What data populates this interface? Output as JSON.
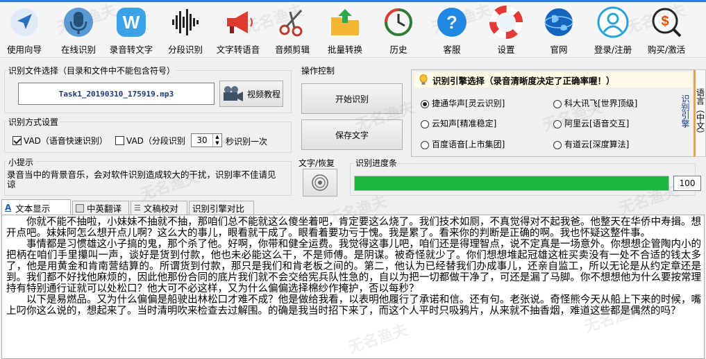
{
  "toolbar": {
    "items": [
      {
        "label": "使用向导",
        "icon": "arrow-cursor-icon"
      },
      {
        "label": "在线识别",
        "icon": "microphone-icon"
      },
      {
        "label": "录音转文字",
        "icon": "w-badge-icon"
      },
      {
        "label": "分段识别",
        "icon": "waveform-icon"
      },
      {
        "label": "文字转语音",
        "icon": "megaphone-icon"
      },
      {
        "label": "音频剪辑",
        "icon": "scissors-icon"
      },
      {
        "label": "批量转换",
        "icon": "folder-arrow-icon"
      },
      {
        "label": "历史",
        "icon": "history-clock-icon"
      },
      {
        "label": "客服",
        "icon": "question-icon"
      },
      {
        "label": "设置",
        "icon": "lifebuoy-icon"
      },
      {
        "label": "官网",
        "icon": "globe-icon"
      },
      {
        "label": "登录/注册",
        "icon": "user-icon"
      },
      {
        "label": "购买/激活",
        "icon": "dollar-coin-icon"
      }
    ]
  },
  "file_select": {
    "title": "识别文件选择（目录和文件中不能包含符号）",
    "filename": "Task1_20190310_175919.mp3",
    "video_button": "视频教程"
  },
  "operations": {
    "title": "操作控制",
    "start_button": "开始识别",
    "save_button": "保存文字"
  },
  "engine": {
    "title": "识别引擎选择（录音清晰度决定了正确率喔！）",
    "side_label": "识别引擎",
    "lang_label": "语言（中文）",
    "options": [
      {
        "label": "捷通华声[灵云识别]",
        "selected": true
      },
      {
        "label": "科大讯飞[世界顶级]",
        "selected": false
      },
      {
        "label": "云知声[精准稳定]",
        "selected": false
      },
      {
        "label": "阿里云[语音交互]",
        "selected": false
      },
      {
        "label": "百度语音[上市集团]",
        "selected": false
      },
      {
        "label": "有道云[深度算法]",
        "selected": false
      }
    ]
  },
  "mode": {
    "title": "识别方式设置",
    "vad_fast": "VAD（语音快速识别）",
    "vad_fast_checked": true,
    "vad_segment": "VAD（分段识别",
    "vad_segment_checked": false,
    "interval_value": "30",
    "interval_suffix": "秒识别一次"
  },
  "tip": {
    "title": "小提示",
    "text": "录音当中的背景音乐，会对软件识别造成较大的干扰，识别率不佳请见谅"
  },
  "restore": {
    "title": "文字/恢复",
    "icon": "disc-icon"
  },
  "progress": {
    "title": "识别进度条",
    "value": 100,
    "value_text": "100",
    "color": "#1cb841"
  },
  "tabs": [
    {
      "label": "文本显示",
      "icon": "text-a-icon",
      "active": true
    },
    {
      "label": "中英翻译",
      "icon": "translate-icon",
      "active": false
    },
    {
      "label": "文稿校对",
      "icon": "list-check-icon",
      "active": false
    },
    {
      "label": "识别引擎对比",
      "icon": "",
      "active": false
    }
  ],
  "watermark": "无名渔夫",
  "content": {
    "paragraphs": [
      "你就不能不抽啦，小妹妹不抽就不抽，那咱们总不能就这么傻坐着吧，肯定要这么烧了。我们技术如厕，不真觉得对不起我爸。他整天在华侨中寿揖。想开点吧。妹妹阿怎么想开点儿啊？这么大的事儿，眼看就干成了。眼看着要功亏于愧。我是累了。看来你的判断是正确的啊。我也怀疑这整件事。",
      "事情都是习惯雄这小子搞的鬼，那个杀了他。好啊，你带和健全运费。我觉得这事儿吧，咱们还是得理智点，说不定真是一场意外。你想想企管陶内小的把柄在咱们手里攥叫一声，谈好是货到付款，他也未必能这么干，不是师傅。是阴谋。被奇怪就少了。你们想想堆起冠雄这桩买卖没有一处不合适的钱太多了，他是用黄金和肯南营结算的。所谓货到付款，那只是我们和肯老板之间的。第二，他认为已经替我们办成事儿，还亲自监工，所以无论是从约定章还是到。我们都不好找他麻烦的，因此他那份合同的底片我们就不会交给宪兵队性急的，自以为把一切都做干净了，可还是漏了马脚。你不想想他为什么要按常理持有特别通行证就可以处松口？他大可不必这样，又为什么偏偏选择棉纱作掩护，否以每秒？",
      "以下是易燃品。又为什么偏偏是船驶出林松口才难不成？他是做给我看，以表明他履行了承诺和信。还有句。老张说。奇怪熊今天从船上下来的时候，嘴上叼你这么说的，想起来了。当时清明吹来检查去过解围。的确是我当时招下来了，而这个人平时只吸鸦片，从来就不抽香烟，难道这些都是偶然的吗？"
    ]
  }
}
